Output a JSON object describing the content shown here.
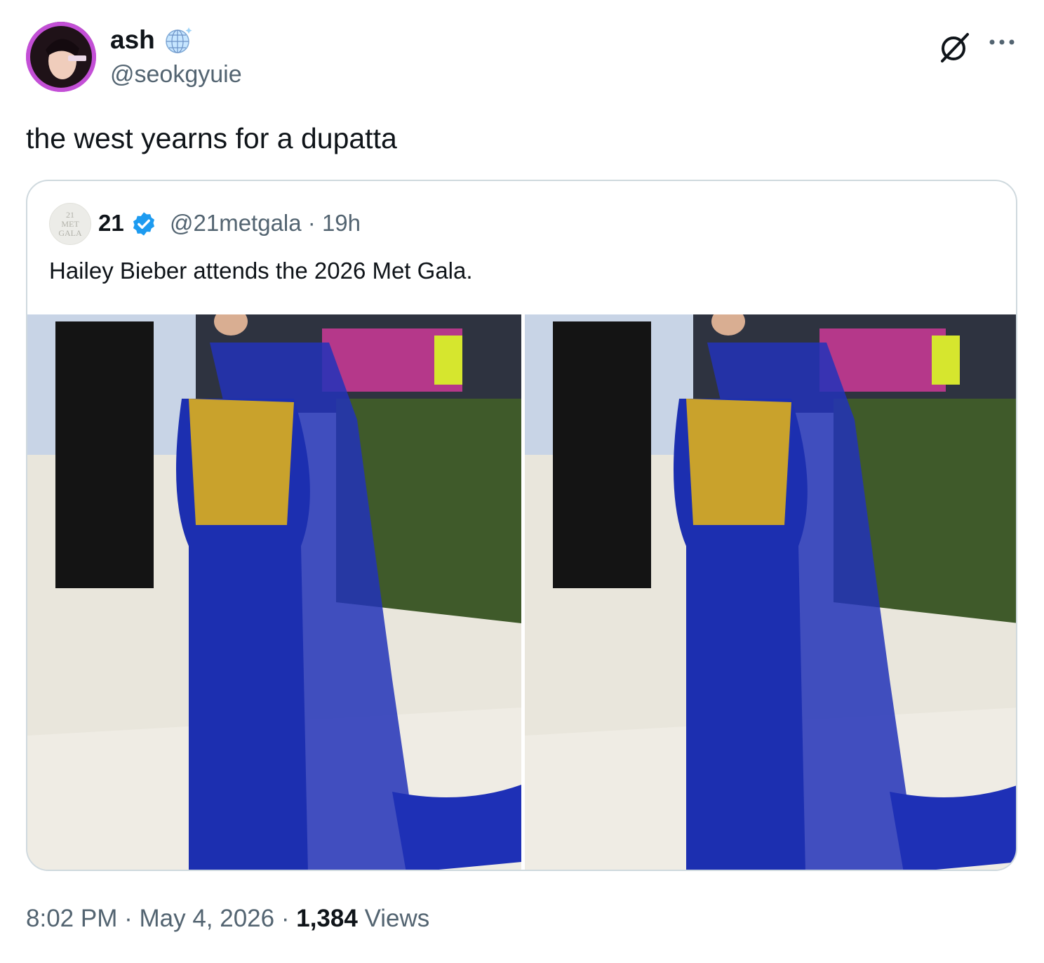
{
  "author": {
    "display_name": "ash",
    "handle": "@seokgyuie",
    "badge_icon": "disco-ball-icon",
    "avatar_icon": "profile-photo"
  },
  "tweet": {
    "text": "the west yearns for a dupatta"
  },
  "header_actions": {
    "grok_icon": "grok-icon",
    "more_icon": "more-icon"
  },
  "quoted": {
    "avatar_lines": [
      "21",
      "MET",
      "GALA"
    ],
    "display_name": "21",
    "verified_icon": "verified-badge-icon",
    "handle": "@21metgala",
    "separator": "·",
    "time": "19h",
    "text": "Hailey Bieber attends the 2026 Met Gala.",
    "media": [
      "photo-1",
      "photo-2"
    ]
  },
  "footer": {
    "time": "8:02 PM",
    "date": "May 4, 2026",
    "separator": "·",
    "views_count": "1,384",
    "views_label": "Views"
  },
  "colors": {
    "text_primary": "#0f1419",
    "text_secondary": "#536471",
    "border": "#cfd9de",
    "verified_blue": "#1d9bf0",
    "gown_blue": "#1c2fb0",
    "bodice_gold": "#c9a22c"
  }
}
